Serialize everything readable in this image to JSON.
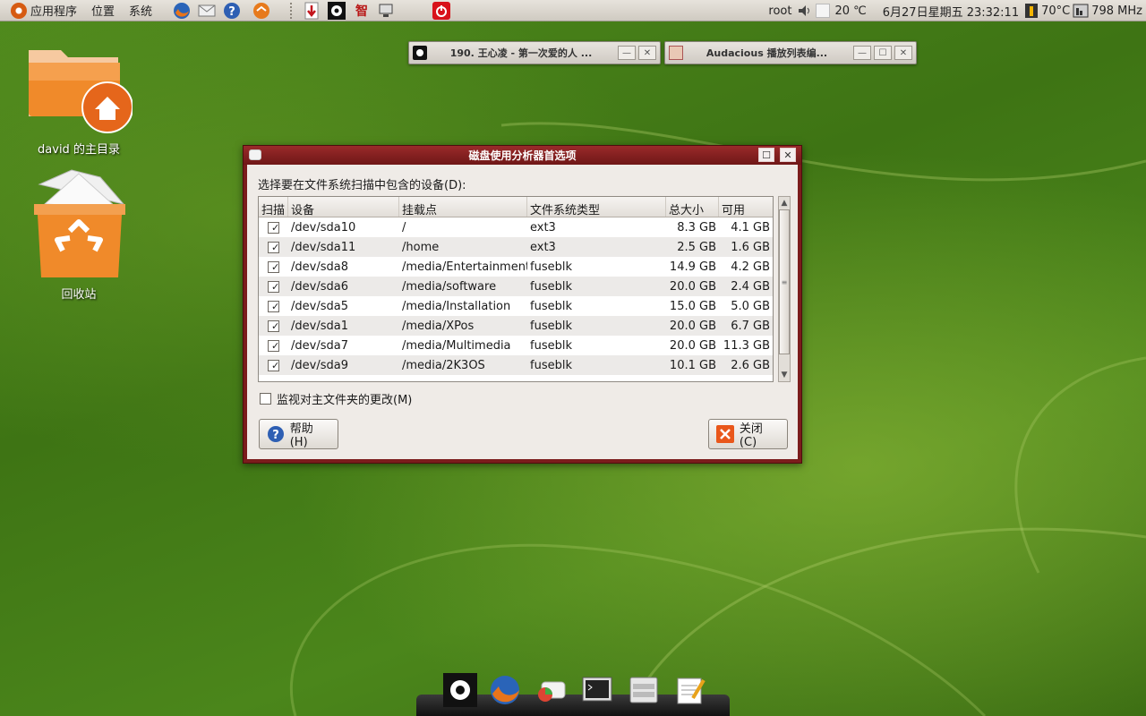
{
  "top_panel": {
    "menu_apps": "应用程序",
    "menu_places": "位置",
    "menu_system": "系统",
    "launchers": [
      "firefox-icon",
      "mail-icon",
      "help-icon",
      "update-icon",
      "download-icon",
      "audacious-icon",
      "zhi-icon",
      "monitor-icon",
      "shutdown-icon"
    ],
    "zhi_glyph": "智",
    "user": "root",
    "temperature": "20 ℃",
    "datetime": "6月27日星期五 23:32:11",
    "cpu_temp": "70°C",
    "cpu_freq": "798 MHz"
  },
  "desktop": {
    "home_label": "david 的主目录",
    "trash_label": "回收站"
  },
  "mini_windows": [
    {
      "title": "190. 王心凌 - 第一次爱的人 ..."
    },
    {
      "title": "Audacious 播放列表编..."
    }
  ],
  "dialog": {
    "title": "磁盘使用分析器首选项",
    "prompt": "选择要在文件系统扫描中包含的设备(D):",
    "columns": [
      "扫描",
      "设备",
      "挂载点",
      "文件系统类型",
      "总大小",
      "可用"
    ],
    "rows": [
      {
        "device": "/dev/sda10",
        "mount": "/",
        "fs": "ext3",
        "size": "8.3 GB",
        "avail": "4.1 GB"
      },
      {
        "device": "/dev/sda11",
        "mount": "/home",
        "fs": "ext3",
        "size": "2.5 GB",
        "avail": "1.6 GB"
      },
      {
        "device": "/dev/sda8",
        "mount": "/media/Entertainment",
        "fs": "fuseblk",
        "size": "14.9 GB",
        "avail": "4.2 GB"
      },
      {
        "device": "/dev/sda6",
        "mount": "/media/software",
        "fs": "fuseblk",
        "size": "20.0 GB",
        "avail": "2.4 GB"
      },
      {
        "device": "/dev/sda5",
        "mount": "/media/Installation",
        "fs": "fuseblk",
        "size": "15.0 GB",
        "avail": "5.0 GB"
      },
      {
        "device": "/dev/sda1",
        "mount": "/media/XPos",
        "fs": "fuseblk",
        "size": "20.0 GB",
        "avail": "6.7 GB"
      },
      {
        "device": "/dev/sda7",
        "mount": "/media/Multimedia",
        "fs": "fuseblk",
        "size": "20.0 GB",
        "avail": "11.3 GB"
      },
      {
        "device": "/dev/sda9",
        "mount": "/media/2K3OS",
        "fs": "fuseblk",
        "size": "10.1 GB",
        "avail": "2.6 GB"
      }
    ],
    "checked": "✓",
    "monitor_label": "监视对主文件夹的更改(M)",
    "help_button": "帮助(H)",
    "close_button": "关闭(C)"
  },
  "dock": [
    "audacious-icon",
    "firefox-icon",
    "disk-usage-icon",
    "terminal-icon",
    "file-manager-icon",
    "text-editor-icon"
  ],
  "colors": {
    "desktop_green": "#3e7414",
    "dialog_frame": "#7b1c1c",
    "panel_bg": "#dcd8d0"
  }
}
